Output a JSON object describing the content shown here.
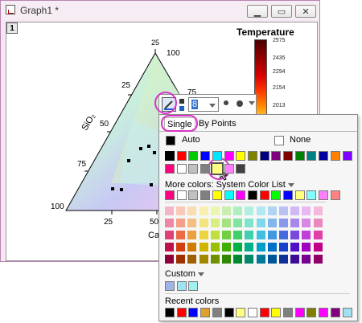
{
  "window": {
    "title": "Graph1 *",
    "minimize": "▁",
    "maximize": "▭",
    "close": "✕",
    "layer_number": "1"
  },
  "plot": {
    "top_label": "100",
    "left_label": "100",
    "sio2_label": "SiO₂",
    "cao_label": "CaO",
    "left_ticks": [
      "25",
      "50",
      "75"
    ],
    "bottom_ticks": [
      "25",
      "50"
    ],
    "right_tick": "75"
  },
  "colorscale": {
    "title": "Temperature",
    "ticks": [
      "2575",
      "2435",
      "2294",
      "2154",
      "2013"
    ]
  },
  "toolbar": {
    "width_value": "8"
  },
  "popup": {
    "tab_single": "Single",
    "tab_by_points": "By Points",
    "auto_label": "Auto",
    "none_label": "None",
    "more_colors_label": "More colors: System Color List",
    "custom_label": "Custom",
    "recent_label": "Recent colors",
    "basic_row1": [
      "#000000",
      "#ff0000",
      "#00cc00",
      "#0000ff",
      "#00e5ff",
      "#ff00ff",
      "#ffff00",
      "#808000",
      "#000080",
      "#800080",
      "#800000",
      "#008000",
      "#008080",
      "#0000a0",
      "#ff8000",
      "#8000ff"
    ],
    "basic_row2": [
      "#ff0080",
      "#ffffff",
      "#c0c0c0",
      "#808080",
      "#ffff80",
      "#ff80ff",
      "#404040"
    ],
    "system_row": [
      "#ff0080",
      "#ffffff",
      "#c0c0c0",
      "#808080",
      "#ffff00",
      "#00ffff",
      "#ff00ff",
      "#000000",
      "#ff0000",
      "#00ff00",
      "#0000ff",
      "#ffff80",
      "#80ffff",
      "#ff80ff",
      "#ff8080"
    ],
    "grid_rows": [
      [
        "#f4b6c6",
        "#f9c8b8",
        "#f9dcb0",
        "#f9f0b0",
        "#eaf6b0",
        "#c8efb0",
        "#b0efc0",
        "#b0efe0",
        "#b0e8f4",
        "#b0d4f4",
        "#b8c0f4",
        "#cfb8f4",
        "#e8b8f0",
        "#f4b8dc"
      ],
      [
        "#ee88a4",
        "#f4a088",
        "#f4c080",
        "#f4e480",
        "#d8ee80",
        "#a4e480",
        "#80e49c",
        "#80e4cc",
        "#80d8ec",
        "#80b8ec",
        "#8898ec",
        "#a888ec",
        "#d888e4",
        "#ec88c0"
      ],
      [
        "#e04078",
        "#ec6c48",
        "#eca040",
        "#ecd440",
        "#c0e040",
        "#70d040",
        "#40d068",
        "#40d0b0",
        "#40c0e0",
        "#4098e0",
        "#4868e0",
        "#7848e0",
        "#c040d8",
        "#e040a8"
      ],
      [
        "#c0104c",
        "#d04010",
        "#d07c00",
        "#d0b400",
        "#98c000",
        "#40b000",
        "#00b040",
        "#00b088",
        "#00a0c8",
        "#0070c8",
        "#1840c8",
        "#5010c8",
        "#a000c0",
        "#c00088"
      ],
      [
        "#900038",
        "#a03000",
        "#a06000",
        "#a08800",
        "#709000",
        "#308800",
        "#008830",
        "#008868",
        "#007898",
        "#005498",
        "#103098",
        "#3c0c98",
        "#780090",
        "#900068"
      ]
    ],
    "custom_row": [
      "#a0b4e8",
      "#a0e4f4",
      "#a0f0f0"
    ],
    "recent_row": [
      "#000000",
      "#ff0000",
      "#0000ff",
      "#e0a030",
      "#808080",
      "#000000",
      "#ffff80",
      "#ffffff",
      "#ff0000",
      "#ffff00",
      "#808080",
      "#ff00ff",
      "#808000",
      "#ff00ff",
      "#800080",
      "#a0e0f0"
    ]
  }
}
